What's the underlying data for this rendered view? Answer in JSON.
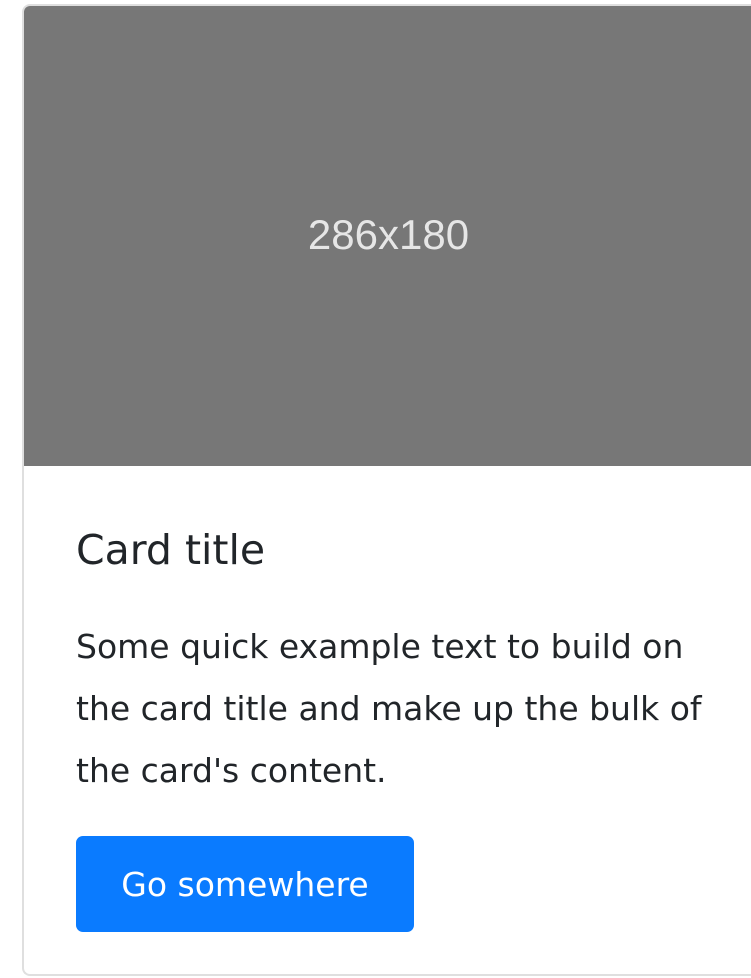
{
  "card": {
    "image_placeholder_text": "286x180",
    "title": "Card title",
    "text": "Some quick example text to build on the card title and make up the bulk of the card's content.",
    "button_label": "Go somewhere"
  },
  "colors": {
    "image_bg": "#777777",
    "button_bg": "#0a7bff",
    "text": "#212529"
  }
}
